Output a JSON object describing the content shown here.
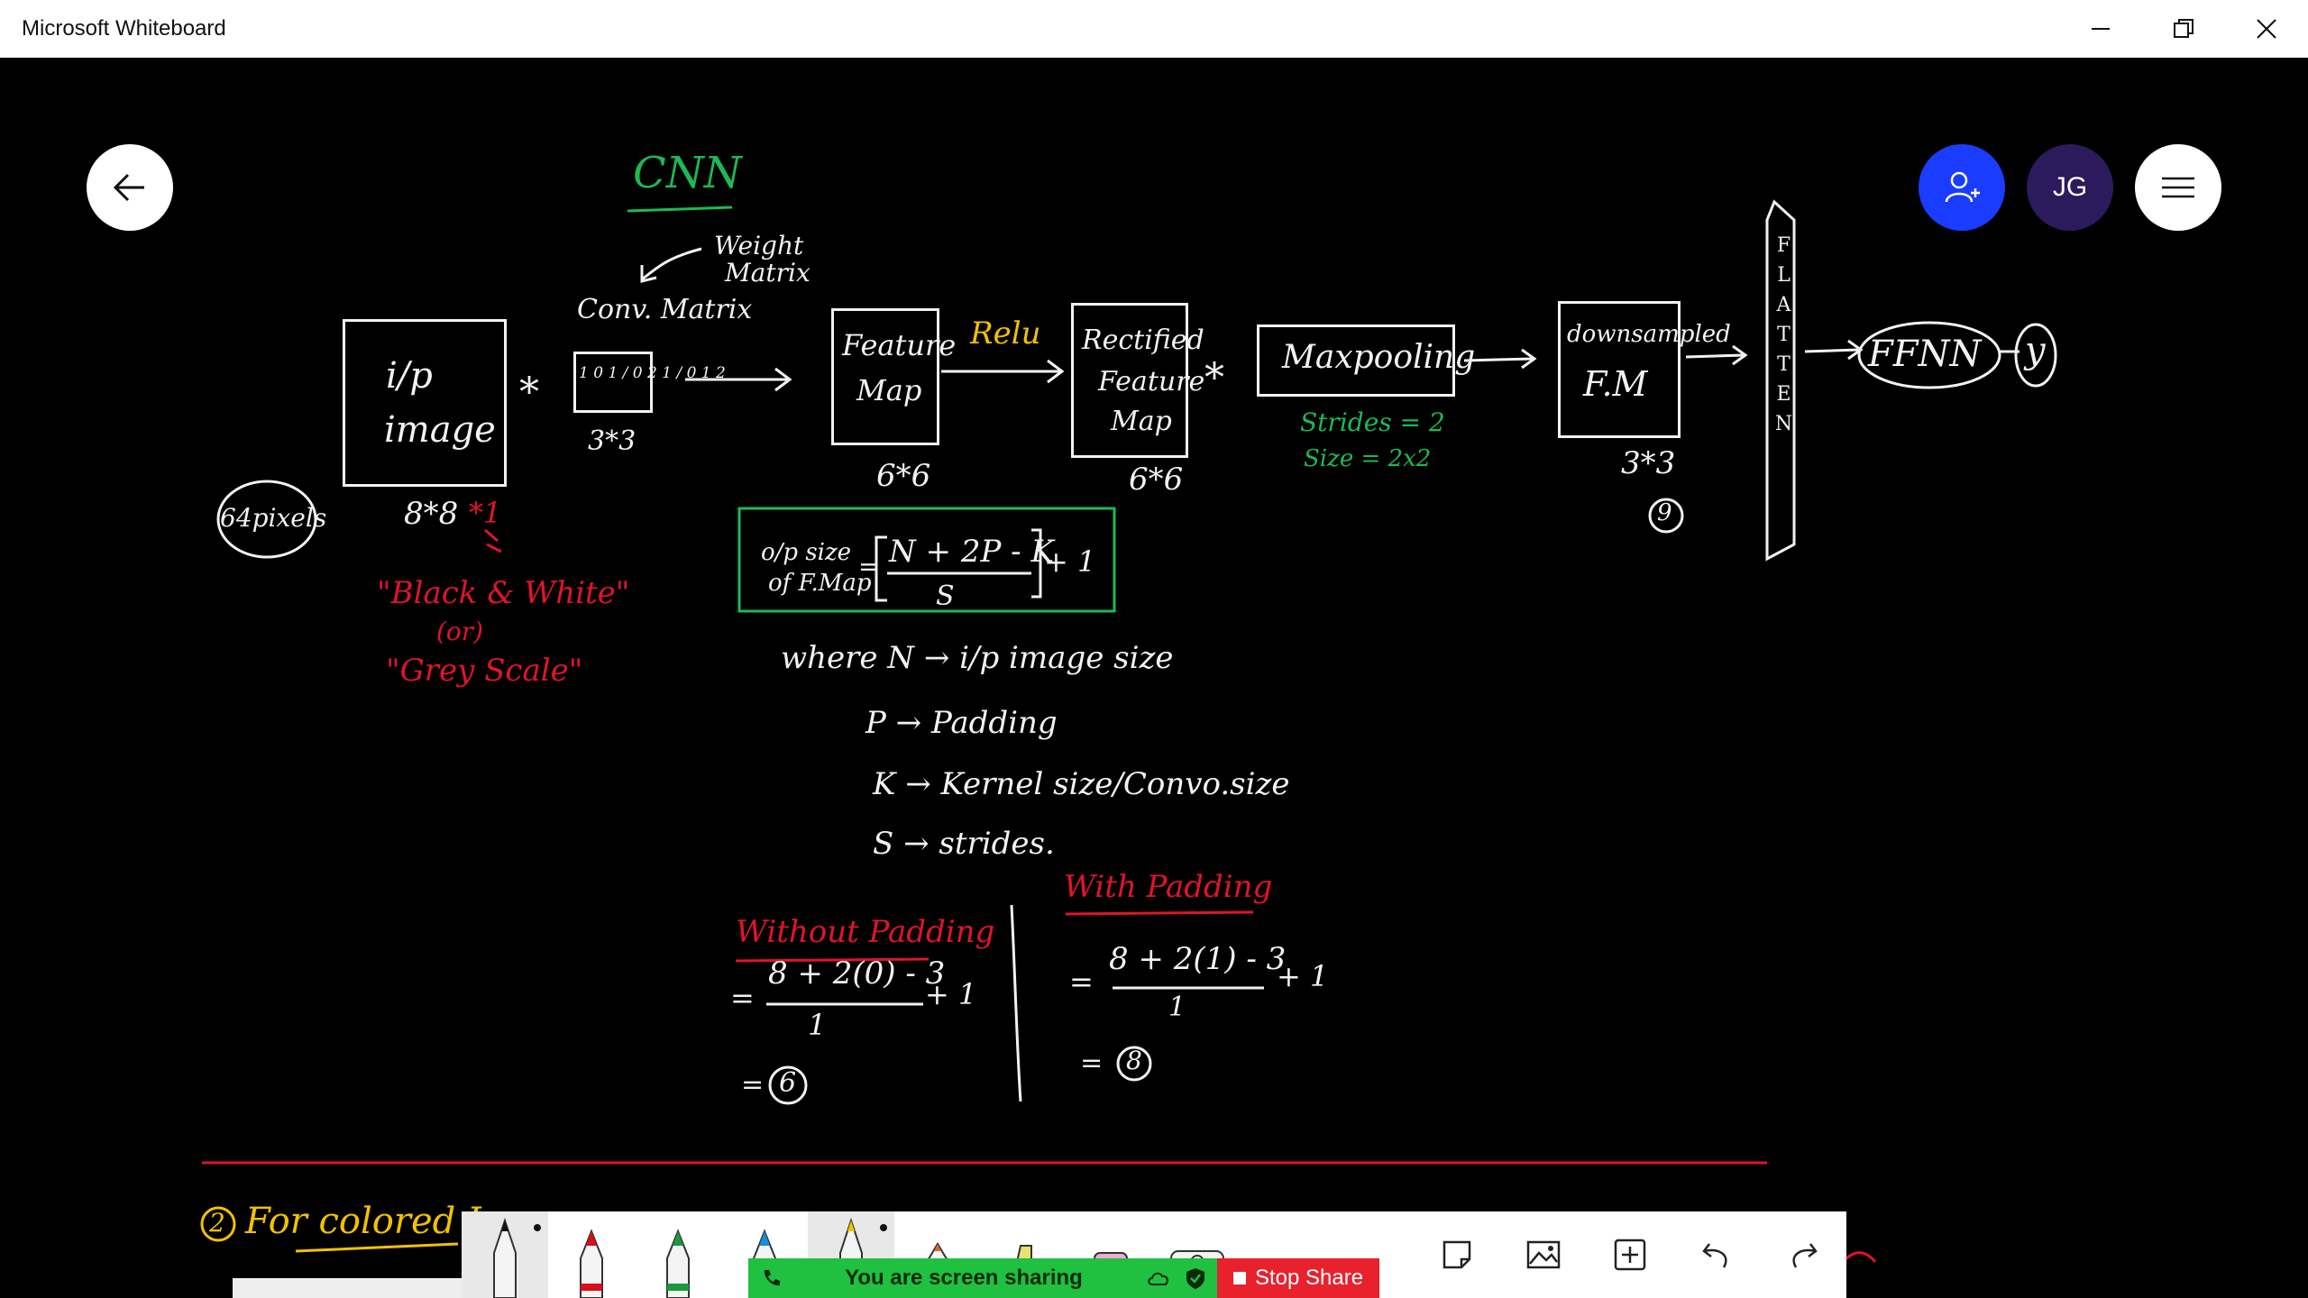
{
  "window": {
    "title": "Microsoft Whiteboard"
  },
  "avatars": {
    "user_initials": "JG"
  },
  "ink": {
    "cnn_title": "CNN",
    "weight_matrix_1": "Weight",
    "weight_matrix_2": "Matrix",
    "conv_matrix": "Conv. Matrix",
    "input_image_1": "i/p",
    "input_image_2": "image",
    "mult_1": "*",
    "kernel_grid": "1 0 1 / 0 2 1 / 0 1 2",
    "kernel_size": "3*3",
    "feature_map_1": "Feature",
    "feature_map_2": "Map",
    "relu": "Relu",
    "rectified_1": "Rectified",
    "rectified_2": "Feature",
    "rectified_3": "Map",
    "mult_2": "*",
    "maxpooling": "Maxpooling",
    "strides": "Strides = 2",
    "size": "Size = 2x2",
    "downsampled_1": "downsampled",
    "downsampled_2": "F.M",
    "ds_size": "3*3",
    "ds_count": "9",
    "flatten": "FLATTEN",
    "ffnn": "FFNN",
    "output_y": "y",
    "fm_size": "6*6",
    "rfm_size": "6*6",
    "pixels": "64pixels",
    "input_size": "8*8",
    "input_channels": "*1",
    "bw_1": "\"Black & White\"",
    "bw_or": "(or)",
    "bw_2": "\"Grey Scale\"",
    "formula_label_1": "o/p size",
    "formula_label_2": "of F.Map",
    "formula_eq": "=",
    "formula_num": "N + 2P - K",
    "formula_den": "S",
    "formula_plus": "+ 1",
    "where_n": "where  N → i/p image size",
    "where_p": "P → Padding",
    "where_k": "K → Kernel size/Convo.size",
    "where_s": "S → strides.",
    "without_padding": "Without Padding",
    "wo_eq": "=",
    "wo_num": "8 + 2(0) - 3",
    "wo_den": "1",
    "wo_plus": "+ 1",
    "wo_res_eq": "=",
    "wo_result": "6",
    "with_padding": "With Padding",
    "wp_eq": "=",
    "wp_num": "8 + 2(1) - 3",
    "wp_den": "1",
    "wp_plus": "+ 1",
    "wp_res_eq": "=",
    "wp_result": "8",
    "section2_num": "2",
    "section2": "For colored Im"
  },
  "share": {
    "sharing_text": "You are screen sharing",
    "stop_label": "Stop Share"
  },
  "colors": {
    "ink_white": "#f2f2f2",
    "ink_green": "#1db954",
    "ink_red": "#e0142a",
    "ink_yellow": "#f2c200",
    "invite_blue": "#1a3cff",
    "avatar_purple": "#2b1a5c",
    "share_green": "#20c040",
    "stop_red": "#e8212d"
  }
}
